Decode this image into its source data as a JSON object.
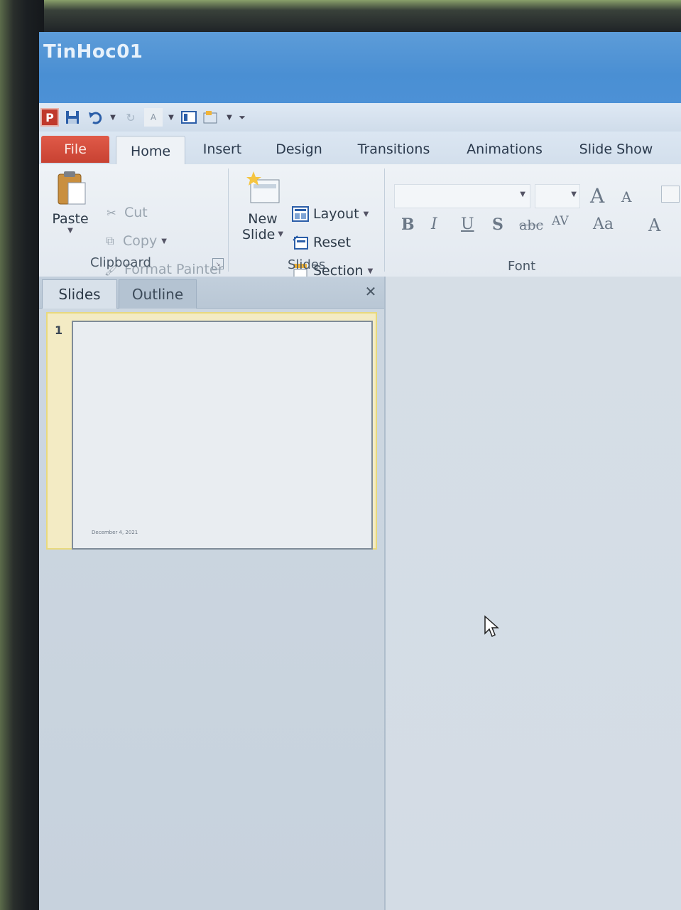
{
  "window": {
    "title": "TinHoc01"
  },
  "qat": {
    "app_logo": "P",
    "icons": [
      "powerpoint-logo-icon",
      "save-icon",
      "undo-icon",
      "redo-icon",
      "font-size-icon",
      "layout-icon",
      "chart-icon",
      "customize-qat-icon"
    ]
  },
  "tabs": {
    "file": "File",
    "home": "Home",
    "insert": "Insert",
    "design": "Design",
    "transitions": "Transitions",
    "animations": "Animations",
    "slide_show": "Slide Show"
  },
  "clipboard": {
    "paste": "Paste",
    "cut": "Cut",
    "copy": "Copy",
    "format_painter": "Format Painter",
    "group_label": "Clipboard"
  },
  "slides_group": {
    "new_slide_line1": "New",
    "new_slide_line2": "Slide",
    "layout": "Layout",
    "reset": "Reset",
    "section": "Section",
    "group_label": "Slides"
  },
  "font_group": {
    "group_label": "Font",
    "grow": "A",
    "shrink": "A",
    "bold": "B",
    "italic": "I",
    "underline": "U",
    "shadow": "S",
    "strikethrough": "abc",
    "spacing": "AV",
    "change_case": "Aa",
    "color": "A"
  },
  "pane": {
    "tab_slides": "Slides",
    "tab_outline": "Outline",
    "close": "✕",
    "slide_number": "1",
    "slide_footer": "December 4, 2021"
  },
  "colors": {
    "title_bar": "#4a8fd3",
    "file_tab": "#c84232",
    "selected_thumb": "#e8d97e"
  }
}
